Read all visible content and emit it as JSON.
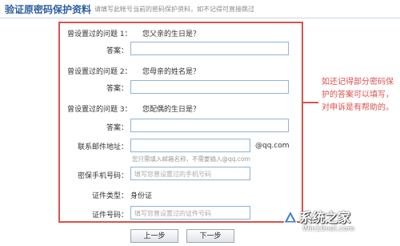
{
  "header": {
    "title": "验证原密码保护资料",
    "subtitle": "请填写此帐号当前的密码保护资料，如不记得可直接跳过"
  },
  "form": {
    "q1": {
      "label": "曾设置过的问题 1：",
      "text": "您父亲的生日是？"
    },
    "q2": {
      "label": "曾设置过的问题 2：",
      "text": "您母亲的姓名是？"
    },
    "q3": {
      "label": "曾设置过的问题 3：",
      "text": "您配偶的生日是？"
    },
    "answer_label": "答案：",
    "email": {
      "label": "联系邮件地址：",
      "suffix": "@qq.com",
      "hint": "您只需填入邮箱名称，不需要输入@qq.com"
    },
    "phone": {
      "label": "密保手机号码：",
      "placeholder": "填写您曾设置过的手机号码"
    },
    "id_type": {
      "label": "证件类型：",
      "value": "身份证"
    },
    "id_number": {
      "label": "证件号码：",
      "placeholder": "填写您曾设置过的证件号码"
    }
  },
  "note": "如还记得部分密码保护的答案可以填写，对申诉是有帮助的。",
  "buttons": {
    "prev": "上一步",
    "next": "下一步"
  },
  "watermark": {
    "main": "系统之家",
    "sub": "Win10net.com"
  },
  "colors": {
    "highlight_border": "#d9534f",
    "title": "#2c5e9e",
    "input_border": "#8fb3d6"
  }
}
